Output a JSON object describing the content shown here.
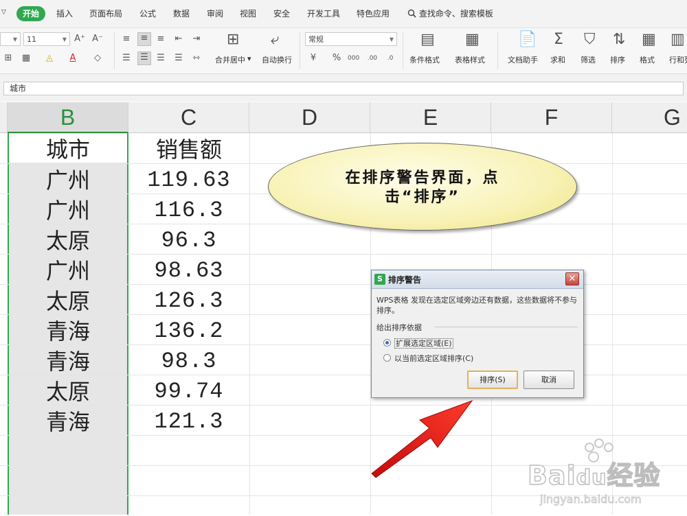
{
  "menubar": {
    "dropdown_glyph": "▽",
    "tabs": [
      "开始",
      "插入",
      "页面布局",
      "公式",
      "数据",
      "审阅",
      "视图",
      "安全",
      "开发工具",
      "特色应用"
    ],
    "search_label": "查找命令、搜索模板"
  },
  "ribbon": {
    "font_size": "11",
    "merge_center": "合并居中",
    "wrap_text": "自动换行",
    "number_format": "常规",
    "conditional_format": "条件格式",
    "table_style": "表格样式",
    "doc_assistant": "文档助手",
    "sum": "求和",
    "filter": "筛选",
    "sort": "排序",
    "format": "格式",
    "row_col": "行和列"
  },
  "formula_bar": {
    "value": "城市"
  },
  "columns": [
    "B",
    "C",
    "D",
    "E",
    "F",
    "G"
  ],
  "table": {
    "rows": [
      [
        "城市",
        "销售额"
      ],
      [
        "广州",
        "119.63"
      ],
      [
        "广州",
        "116.3"
      ],
      [
        "太原",
        "96.3"
      ],
      [
        "广州",
        "98.63"
      ],
      [
        "太原",
        "126.3"
      ],
      [
        "青海",
        "136.2"
      ],
      [
        "青海",
        "98.3"
      ],
      [
        "太原",
        "99.74"
      ],
      [
        "青海",
        "121.3"
      ]
    ]
  },
  "callout": {
    "line1": "在排序警告界面，点",
    "line2": "击“排序”"
  },
  "dialog": {
    "title": "排序警告",
    "close_glyph": "✕",
    "message": "WPS表格 发现在选定区域旁边还有数据，这些数据将不参与排序。",
    "group_label": "给出排序依据",
    "option_expand": "扩展选定区域(E)",
    "option_current": "以当前选定区域排序(C)",
    "btn_sort": "排序(S)",
    "btn_cancel": "取消"
  },
  "watermark": {
    "brand": "Bai",
    "brand_cn": "经验",
    "url": "jingyan.baidu.com"
  },
  "colors": {
    "accent": "#2fa84f",
    "callout_fill": "#f8f2b6",
    "arrow": "#e01818"
  }
}
